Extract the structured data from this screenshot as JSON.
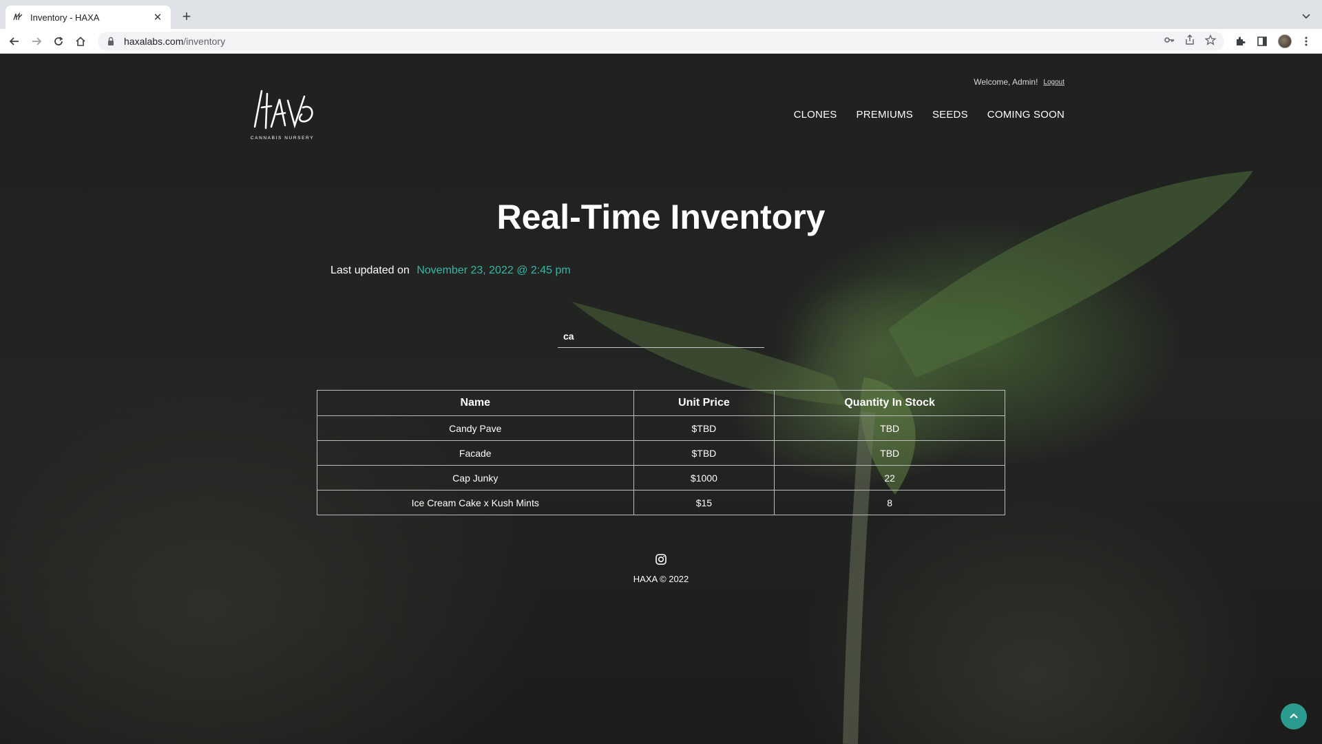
{
  "browser": {
    "tab_title": "Inventory - HAXA",
    "url_host": "haxalabs.com",
    "url_path": "/inventory"
  },
  "header": {
    "welcome": "Welcome, Admin!",
    "logout": "Logout",
    "nav": [
      "CLONES",
      "PREMIUMS",
      "SEEDS",
      "COMING SOON"
    ],
    "logo_text": "HAXA",
    "logo_subtitle": "CANNABIS NURSERY"
  },
  "main": {
    "title": "Real-Time Inventory",
    "updated_label": "Last updated on",
    "updated_value": "November 23, 2022 @ 2:45 pm",
    "search_value": "ca",
    "table": {
      "headers": [
        "Name",
        "Unit Price",
        "Quantity In Stock"
      ],
      "rows": [
        [
          "Candy Pave",
          "$TBD",
          "TBD"
        ],
        [
          "Facade",
          "$TBD",
          "TBD"
        ],
        [
          "Cap Junky",
          "$1000",
          "22"
        ],
        [
          "Ice Cream Cake x Kush Mints",
          "$15",
          "8"
        ]
      ]
    }
  },
  "footer": {
    "copyright": "HAXA © 2022"
  },
  "colors": {
    "accent": "#3bb5a8",
    "scroll_button": "#2a9b8e"
  },
  "icons": [
    "back-icon",
    "forward-icon",
    "reload-icon",
    "home-icon",
    "lock-icon",
    "key-icon",
    "share-icon",
    "star-icon",
    "extensions-icon",
    "side-panel-icon",
    "menu-icon",
    "instagram-icon",
    "chevron-up-icon"
  ]
}
